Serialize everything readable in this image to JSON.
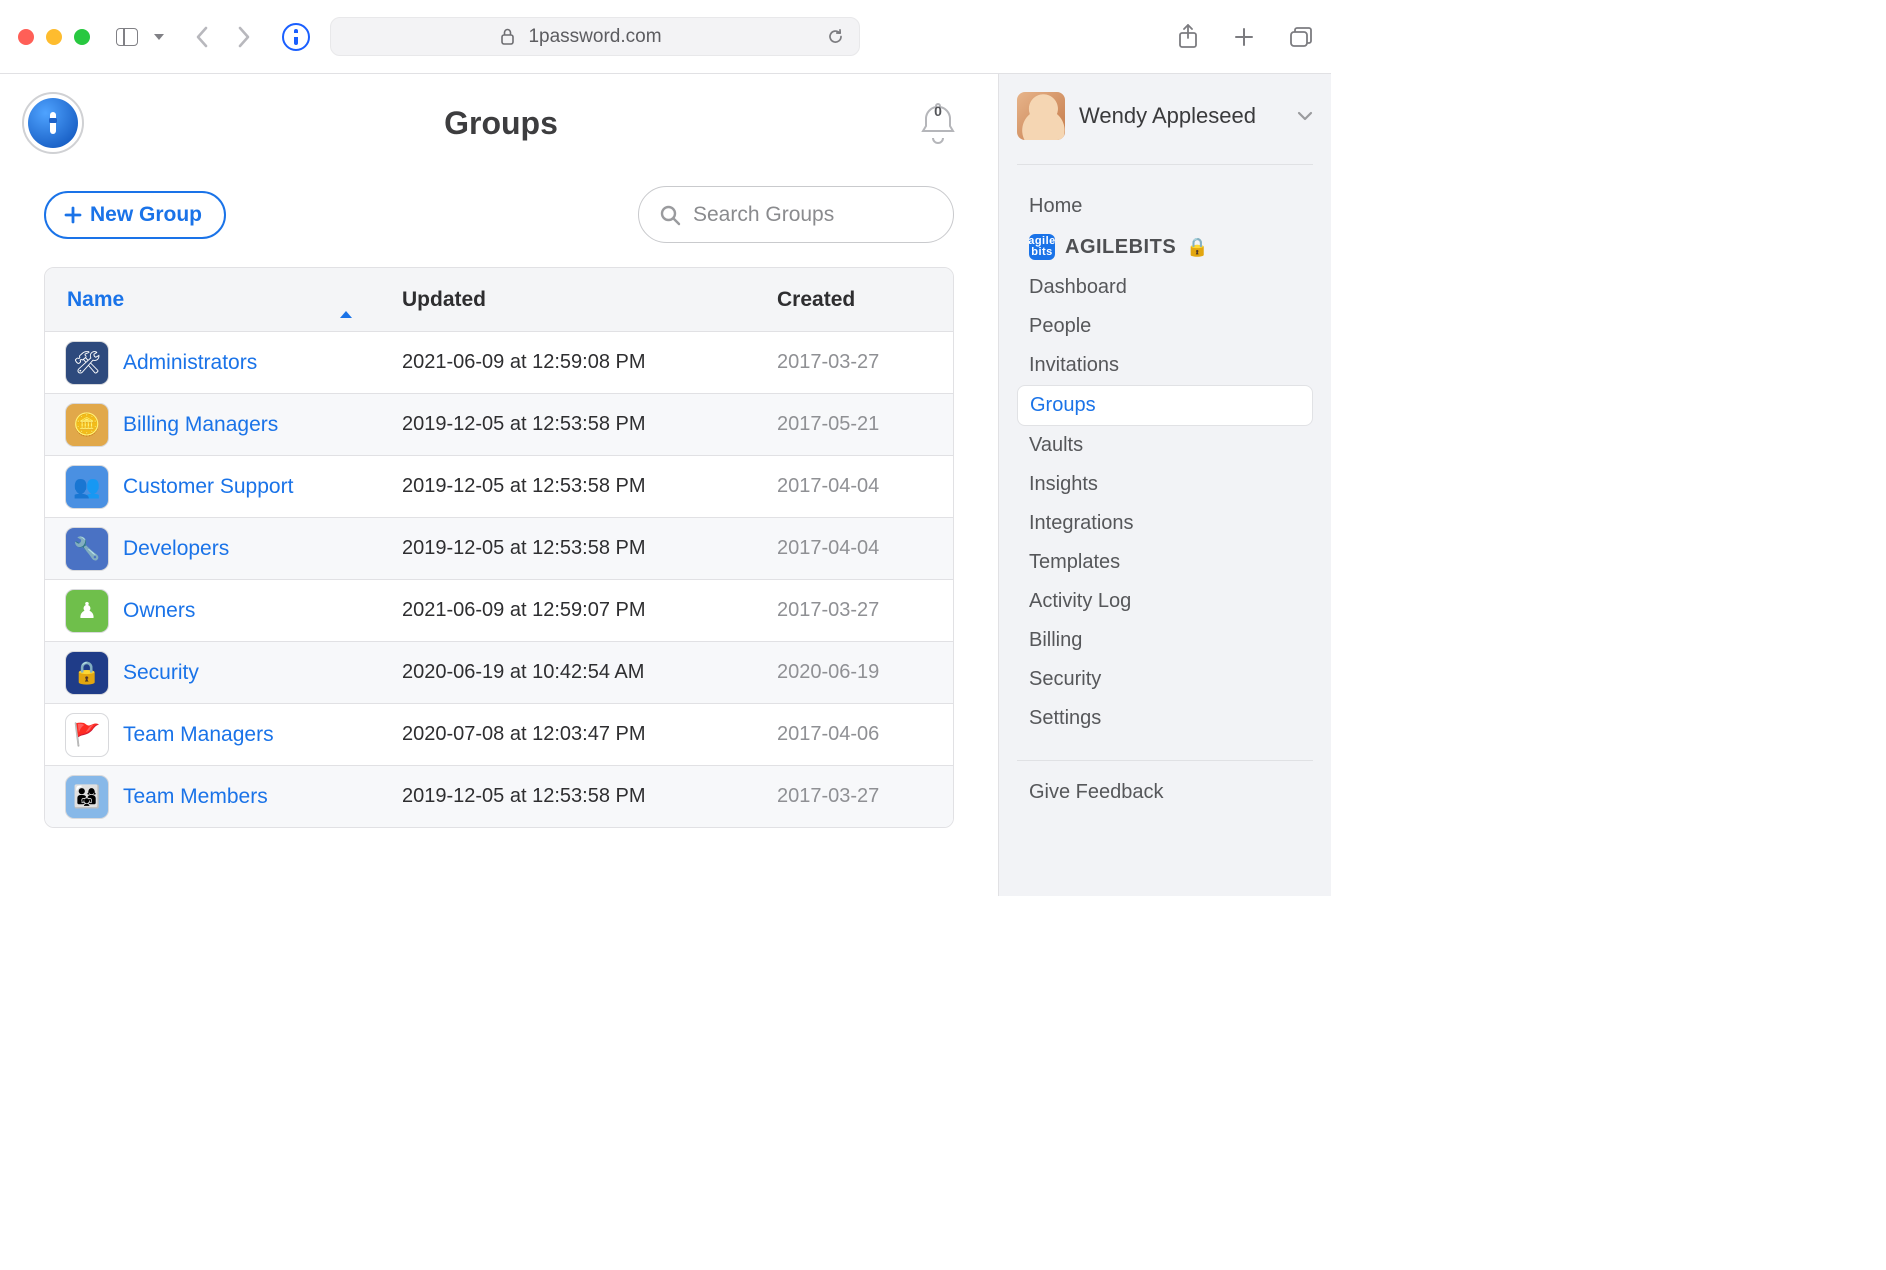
{
  "browser": {
    "url": "1password.com"
  },
  "header": {
    "title": "Groups",
    "notif_count": "0"
  },
  "toolbar": {
    "new_group_label": "New Group",
    "search_placeholder": "Search Groups"
  },
  "table": {
    "col_name": "Name",
    "col_updated": "Updated",
    "col_created": "Created",
    "rows": [
      {
        "name": "Administrators",
        "updated": "2021-06-09 at 12:59:08 PM",
        "created": "2017-03-27",
        "icon_bg": "#2e4a7d",
        "glyph": "🛠"
      },
      {
        "name": "Billing Managers",
        "updated": "2019-12-05 at 12:53:58 PM",
        "created": "2017-05-21",
        "icon_bg": "#e1a84a",
        "glyph": "🪙"
      },
      {
        "name": "Customer Support",
        "updated": "2019-12-05 at 12:53:58 PM",
        "created": "2017-04-04",
        "icon_bg": "#4a90e2",
        "glyph": "👥"
      },
      {
        "name": "Developers",
        "updated": "2019-12-05 at 12:53:58 PM",
        "created": "2017-04-04",
        "icon_bg": "#4a72c4",
        "glyph": "🔧"
      },
      {
        "name": "Owners",
        "updated": "2021-06-09 at 12:59:07 PM",
        "created": "2017-03-27",
        "icon_bg": "#6fbf4b",
        "glyph": "♟"
      },
      {
        "name": "Security",
        "updated": "2020-06-19 at 10:42:54 AM",
        "created": "2020-06-19",
        "icon_bg": "#1f3c88",
        "glyph": "🔒"
      },
      {
        "name": "Team Managers",
        "updated": "2020-07-08 at 12:03:47 PM",
        "created": "2017-04-06",
        "icon_bg": "#ffffff",
        "glyph": "🚩"
      },
      {
        "name": "Team Members",
        "updated": "2019-12-05 at 12:53:58 PM",
        "created": "2017-03-27",
        "icon_bg": "#87b8e8",
        "glyph": "👨‍👩‍👧"
      }
    ]
  },
  "sidebar": {
    "user_name": "Wendy Appleseed",
    "org_name": "AGILEBITS",
    "org_icon_top": "agile",
    "org_icon_bot": "bits",
    "items": {
      "home": "Home",
      "dashboard": "Dashboard",
      "people": "People",
      "invitations": "Invitations",
      "groups": "Groups",
      "vaults": "Vaults",
      "insights": "Insights",
      "integrations": "Integrations",
      "templates": "Templates",
      "activity_log": "Activity Log",
      "billing": "Billing",
      "security": "Security",
      "settings": "Settings"
    },
    "feedback": "Give Feedback"
  }
}
